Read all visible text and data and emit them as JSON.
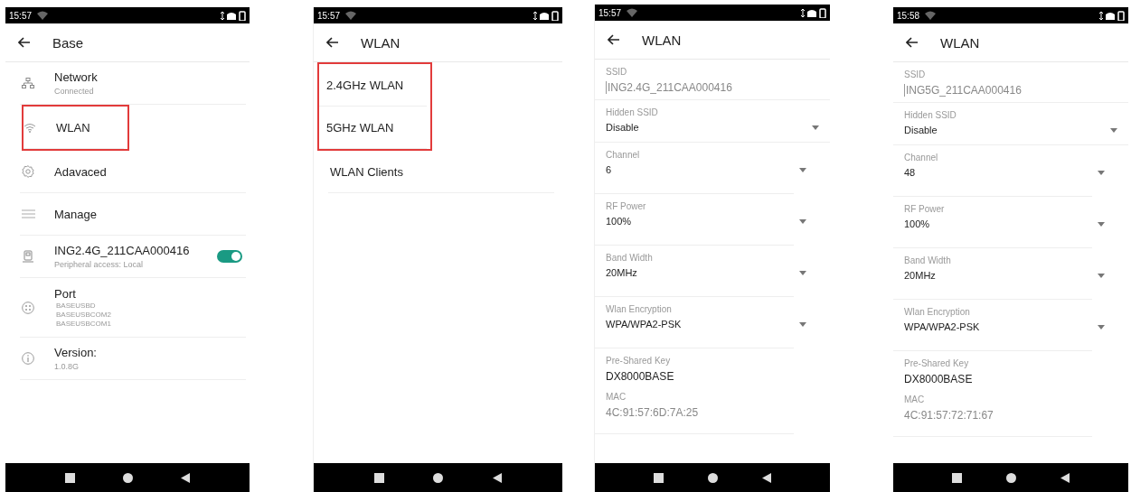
{
  "phones": [
    {
      "kind": "icon-menu",
      "time": "15:57",
      "title": "Base",
      "items": [
        {
          "label": "Network",
          "sublines": [
            "Connected"
          ],
          "highlighted": false
        },
        {
          "label": "WLAN",
          "highlighted": true
        },
        {
          "label": "Adavaced",
          "highlighted": false
        },
        {
          "label": "Manage",
          "highlighted": false
        },
        {
          "label": "ING2.4G_211CAA000416",
          "sublines": [
            "Peripheral access: Local"
          ],
          "highlighted": false,
          "toggle": {
            "on": true
          }
        },
        {
          "label": "Port",
          "sublines": [
            "BASEUSBD",
            "BASEUSBCOM2",
            "BASEUSBCOM1"
          ],
          "highlighted": false
        },
        {
          "label": "Version:",
          "sublines": [
            "1.0.8G"
          ],
          "highlighted": false
        }
      ]
    },
    {
      "kind": "menu",
      "time": "15:57",
      "title": "WLAN",
      "items": [
        {
          "label": "2.4GHz WLAN",
          "highlighted": true
        },
        {
          "label": "5GHz WLAN",
          "highlighted": true
        },
        {
          "label": "WLAN Clients",
          "highlighted": false
        }
      ]
    },
    {
      "kind": "form",
      "time": "15:57",
      "title": "WLAN",
      "fields": [
        {
          "kind": "input",
          "label": "SSID",
          "value": "ING2.4G_211CAA000416"
        },
        {
          "kind": "select",
          "label": "Hidden SSID",
          "value": "Disable"
        },
        {
          "kind": "select",
          "label": "Channel",
          "value": "6"
        },
        {
          "kind": "select",
          "label": "RF Power",
          "value": "100%"
        },
        {
          "kind": "select",
          "label": "Band Width",
          "value": "20MHz"
        },
        {
          "kind": "select",
          "label": "Wlan Encryption",
          "value": "WPA/WPA2-PSK"
        },
        {
          "kind": "key",
          "label": "Pre-Shared Key",
          "value": "DX8000BASE"
        },
        {
          "kind": "info",
          "label": "MAC",
          "value": "4C:91:57:6D:7A:25"
        }
      ]
    },
    {
      "kind": "form",
      "time": "15:58",
      "title": "WLAN",
      "fields": [
        {
          "kind": "input",
          "label": "SSID",
          "value": "ING5G_211CAA000416"
        },
        {
          "kind": "select",
          "label": "Hidden SSID",
          "value": "Disable"
        },
        {
          "kind": "select",
          "label": "Channel",
          "value": "48"
        },
        {
          "kind": "select",
          "label": "RF Power",
          "value": "100%"
        },
        {
          "kind": "select",
          "label": "Band Width",
          "value": "20MHz"
        },
        {
          "kind": "select",
          "label": "Wlan Encryption",
          "value": "WPA/WPA2-PSK"
        },
        {
          "kind": "key",
          "label": "Pre-Shared Key",
          "value": "DX8000BASE"
        },
        {
          "kind": "info",
          "label": "MAC",
          "value": "4C:91:57:72:71:67"
        }
      ]
    }
  ]
}
